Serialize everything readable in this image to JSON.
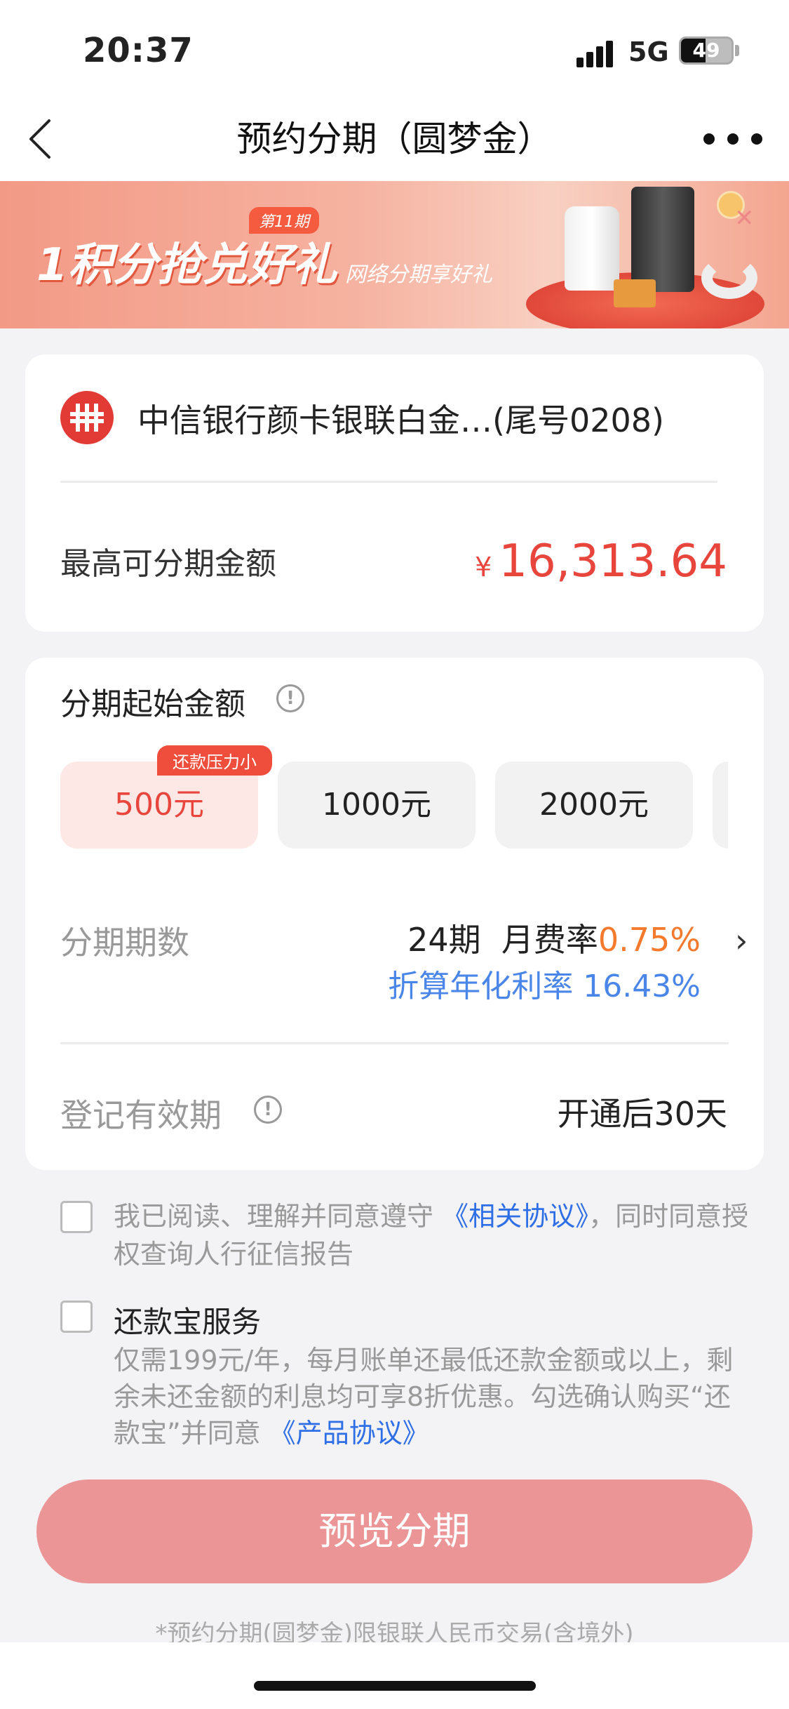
{
  "status_bar": {
    "time": "20:37",
    "network": "5G",
    "battery_level": "49"
  },
  "nav": {
    "title": "预约分期（圆梦金）"
  },
  "banner": {
    "issue_badge": "第11期",
    "headline": "1积分抢兑好礼",
    "subtitle": "网络分期享好礼"
  },
  "account": {
    "bank_name": "中信银行颜卡银联白金…(尾号0208)",
    "max_label": "最高可分期金额",
    "currency": "¥",
    "max_amount": "16,313.64"
  },
  "start_amount": {
    "label": "分期起始金额",
    "tag": "还款压力小",
    "options": [
      "500元",
      "1000元",
      "2000元"
    ],
    "selected_index": 0
  },
  "period": {
    "label": "分期期数",
    "count": "24期",
    "fee_label": "月费率",
    "fee_rate": "0.75%",
    "apr": "折算年化利率 16.43%"
  },
  "validity": {
    "label": "登记有效期",
    "value": "开通后30天"
  },
  "agreement": {
    "text_before": "我已阅读、理解并同意遵守",
    "link": "《相关协议》",
    "text_after": "，同时同意授权查询人行征信报告"
  },
  "repay_service": {
    "title": "还款宝服务",
    "desc_before": "仅需199元/年，每月账单还最低还款金额或以上，剩余未还金额的利息均可享8折优惠。勾选确认购买“还款宝”并同意",
    "link": "《产品协议》"
  },
  "primary_button": "预览分期",
  "footnote": "*预约分期(圆梦金)限银联人民币交易(含境外)",
  "colors": {
    "accent": "#e8453c",
    "link": "#2f6fe6",
    "button": "#ec9597",
    "rate": "#f57a2d"
  }
}
